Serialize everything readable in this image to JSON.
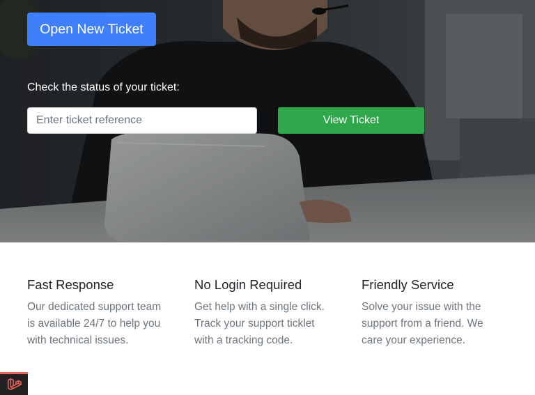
{
  "hero": {
    "open_ticket_label": "Open New Ticket",
    "status_label": "Check the status of your ticket:",
    "ticket_input": {
      "placeholder": "Enter ticket reference",
      "value": ""
    },
    "view_ticket_label": "View Ticket"
  },
  "features": [
    {
      "title": "Fast Response",
      "lines": [
        "Our dedicated support team",
        "is available 24/7 to help you",
        "with technical issues."
      ]
    },
    {
      "title": "No Login Required",
      "lines": [
        "Get help with a single click.",
        "Track your support ticklet",
        "with a tracking code."
      ]
    },
    {
      "title": "Friendly Service",
      "lines": [
        "Solve your issue with the",
        "support from a friend. We",
        "care your experience."
      ]
    }
  ],
  "debug_badge": {
    "icon": "laravel-logo-icon"
  },
  "colors": {
    "primary": "#3f7ffb",
    "success": "#2ea84a",
    "heading": "#212529",
    "muted": "#6c757d",
    "badge_accent": "#f4645f"
  }
}
